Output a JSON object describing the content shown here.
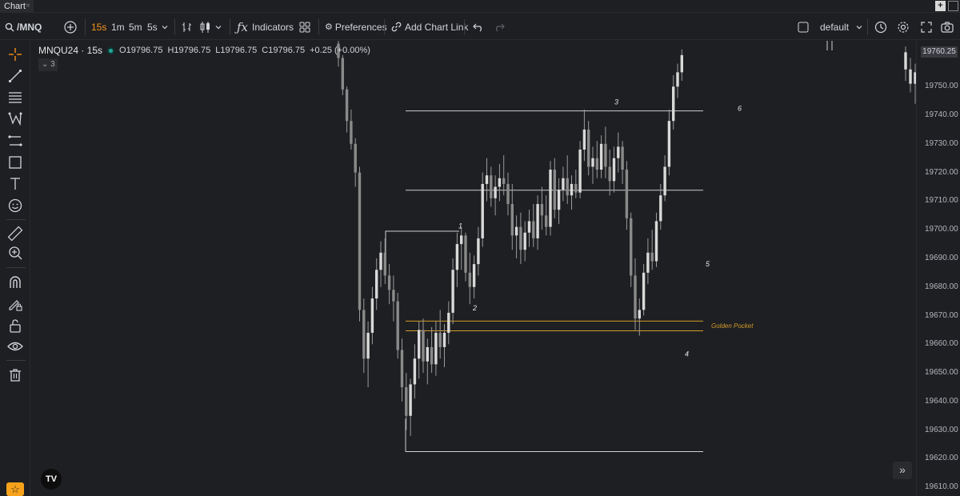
{
  "tab": {
    "title": "Chart",
    "close": "×"
  },
  "window": {
    "plus": "+",
    "maximize": ""
  },
  "toolbar": {
    "symbol": "/MNQ",
    "timeframes": [
      "15s",
      "1m",
      "5m",
      "5s"
    ],
    "active_timeframe": "15s",
    "indicators_label": "Indicators",
    "preferences_label": "Preferences",
    "add_chart_link_label": "Add Chart Link",
    "layout_name": "default"
  },
  "legend": {
    "symbol": "MNQU24 · 15s",
    "open": "O19796.75",
    "high": "H19796.75",
    "low": "L19796.75",
    "close": "C19796.75",
    "change": "+0.25 (+0.00%)",
    "collapse_count": "3"
  },
  "price_axis": {
    "ticks": [
      "19750.00",
      "19740.00",
      "19730.00",
      "19720.00",
      "19710.00",
      "19700.00",
      "19690.00",
      "19680.00",
      "19670.00",
      "19660.00",
      "19650.00",
      "19640.00",
      "19630.00",
      "19620.00",
      "19610.00"
    ],
    "last_price": "19760.25"
  },
  "annotations": {
    "labels": [
      "1",
      "2",
      "3",
      "4",
      "5",
      "6"
    ],
    "golden_pocket": "Golden Pocket"
  },
  "colors": {
    "background": "#1e1f22",
    "accent": "#f7931a",
    "golden_pocket": "#d19a2a",
    "candle": "#d9d9d9",
    "wick": "#9a9a9a"
  },
  "chart_data": {
    "type": "candlestick",
    "symbol": "MNQU24",
    "interval": "15s",
    "ylim": [
      19607,
      19766
    ],
    "y_ticks": [
      19610,
      19620,
      19630,
      19640,
      19650,
      19660,
      19670,
      19680,
      19690,
      19700,
      19710,
      19720,
      19730,
      19740,
      19750
    ],
    "waves": [
      {
        "label": "1",
        "price": 19701
      },
      {
        "label": "2",
        "price": 19673
      },
      {
        "label": "3",
        "price": 19741
      },
      {
        "label": "4",
        "price": 19663
      },
      {
        "label": "5",
        "price": 19690
      },
      {
        "label": "6",
        "price": 19760
      }
    ],
    "horizontal_levels": [
      {
        "price": 19741.5,
        "kind": "line"
      },
      {
        "price": 19713.8,
        "kind": "line"
      },
      {
        "price": 19668.1,
        "kind": "golden_pocket"
      },
      {
        "price": 19664.7,
        "kind": "golden_pocket"
      },
      {
        "price": 19622.5,
        "kind": "line"
      }
    ],
    "candles": [
      [
        19765,
        19766,
        19757,
        19760
      ],
      [
        19760,
        19761,
        19747,
        19749
      ],
      [
        19749,
        19750,
        19734,
        19738
      ],
      [
        19738,
        19742,
        19728,
        19730
      ],
      [
        19730,
        19732,
        19715,
        19720
      ],
      [
        19720,
        19722,
        19668,
        19672
      ],
      [
        19672,
        19676,
        19650,
        19655
      ],
      [
        19655,
        19668,
        19645,
        19664
      ],
      [
        19664,
        19680,
        19660,
        19676
      ],
      [
        19676,
        19690,
        19672,
        19686
      ],
      [
        19686,
        19696,
        19680,
        19692
      ],
      [
        19692,
        19697,
        19681,
        19684
      ],
      [
        19684,
        19688,
        19674,
        19679
      ],
      [
        19679,
        19684,
        19668,
        19675
      ],
      [
        19675,
        19678,
        19655,
        19658
      ],
      [
        19658,
        19662,
        19640,
        19645
      ],
      [
        19645,
        19650,
        19630,
        19635
      ],
      [
        19635,
        19648,
        19628,
        19646
      ],
      [
        19646,
        19660,
        19641,
        19655
      ],
      [
        19655,
        19668,
        19648,
        19665
      ],
      [
        19665,
        19669,
        19650,
        19654
      ],
      [
        19654,
        19662,
        19646,
        19659
      ],
      [
        19659,
        19666,
        19650,
        19653
      ],
      [
        19653,
        19668,
        19649,
        19664
      ],
      [
        19664,
        19672,
        19655,
        19659
      ],
      [
        19659,
        19667,
        19652,
        19664
      ],
      [
        19664,
        19675,
        19660,
        19671
      ],
      [
        19671,
        19690,
        19667,
        19686
      ],
      [
        19686,
        19699,
        19680,
        19695
      ],
      [
        19695,
        19701,
        19686,
        19698
      ],
      [
        19698,
        19699,
        19682,
        19685
      ],
      [
        19685,
        19692,
        19674,
        19680
      ],
      [
        19680,
        19691,
        19676,
        19688
      ],
      [
        19688,
        19701,
        19684,
        19697
      ],
      [
        19697,
        19720,
        19694,
        19716
      ],
      [
        19716,
        19725,
        19710,
        19719
      ],
      [
        19719,
        19722,
        19708,
        19711
      ],
      [
        19711,
        19719,
        19705,
        19715
      ],
      [
        19715,
        19723,
        19710,
        19718
      ],
      [
        19718,
        19726,
        19712,
        19716
      ],
      [
        19716,
        19720,
        19705,
        19709
      ],
      [
        19709,
        19716,
        19693,
        19698
      ],
      [
        19698,
        19705,
        19690,
        19701
      ],
      [
        19701,
        19706,
        19688,
        19693
      ],
      [
        19693,
        19703,
        19689,
        19699
      ],
      [
        19699,
        19707,
        19694,
        19703
      ],
      [
        19703,
        19709,
        19694,
        19697
      ],
      [
        19697,
        19712,
        19693,
        19709
      ],
      [
        19709,
        19715,
        19700,
        19705
      ],
      [
        19705,
        19712,
        19698,
        19701
      ],
      [
        19701,
        19724,
        19698,
        19721
      ],
      [
        19721,
        19725,
        19704,
        19707
      ],
      [
        19707,
        19718,
        19702,
        19714
      ],
      [
        19714,
        19722,
        19710,
        19718
      ],
      [
        19718,
        19726,
        19709,
        19712
      ],
      [
        19712,
        19719,
        19707,
        19716
      ],
      [
        19716,
        19721,
        19711,
        19713
      ],
      [
        19713,
        19731,
        19711,
        19728
      ],
      [
        19728,
        19742,
        19724,
        19735
      ],
      [
        19735,
        19738,
        19719,
        19722
      ],
      [
        19722,
        19729,
        19716,
        19725
      ],
      [
        19725,
        19731,
        19718,
        19721
      ],
      [
        19721,
        19733,
        19718,
        19730
      ],
      [
        19730,
        19736,
        19718,
        19722
      ],
      [
        19722,
        19728,
        19712,
        19717
      ],
      [
        19717,
        19729,
        19713,
        19725
      ],
      [
        19725,
        19734,
        19720,
        19729
      ],
      [
        19729,
        19731,
        19716,
        19721
      ],
      [
        19721,
        19724,
        19700,
        19704
      ],
      [
        19704,
        19706,
        19680,
        19684
      ],
      [
        19684,
        19690,
        19665,
        19669
      ],
      [
        19669,
        19676,
        19663,
        19672
      ],
      [
        19672,
        19688,
        19670,
        19685
      ],
      [
        19685,
        19697,
        19681,
        19692
      ],
      [
        19692,
        19700,
        19686,
        19689
      ],
      [
        19689,
        19706,
        19687,
        19703
      ],
      [
        19703,
        19716,
        19700,
        19712
      ],
      [
        19712,
        19726,
        19710,
        19722
      ],
      [
        19722,
        19742,
        19719,
        19738
      ],
      [
        19738,
        19754,
        19735,
        19750
      ],
      [
        19750,
        19758,
        19746,
        19755
      ],
      [
        19755,
        19763,
        19752,
        19761
      ]
    ]
  }
}
